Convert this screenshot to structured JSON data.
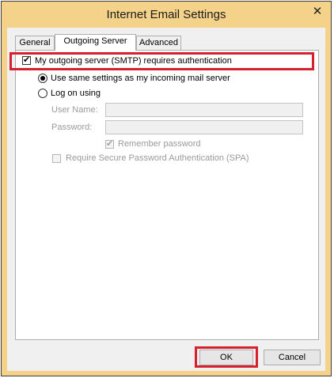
{
  "window": {
    "title": "Internet Email Settings",
    "close_glyph": "✕"
  },
  "tabs": [
    {
      "label": "General"
    },
    {
      "label": "Outgoing Server"
    },
    {
      "label": "Advanced"
    }
  ],
  "outgoing": {
    "smtp_auth_label": "My outgoing server (SMTP) requires authentication",
    "smtp_auth_checked": true,
    "use_same_label": "Use same settings as my incoming mail server",
    "use_same_selected": true,
    "log_on_label": "Log on using",
    "log_on_selected": false,
    "username_label": "User Name:",
    "username_value": "",
    "password_label": "Password:",
    "password_value": "",
    "remember_label": "Remember password",
    "remember_checked": true,
    "spa_label": "Require Secure Password Authentication (SPA)",
    "spa_checked": false
  },
  "buttons": {
    "ok_label": "OK",
    "cancel_label": "Cancel"
  },
  "colors": {
    "title_bar": "#f5d28a",
    "highlight": "#d62030"
  }
}
